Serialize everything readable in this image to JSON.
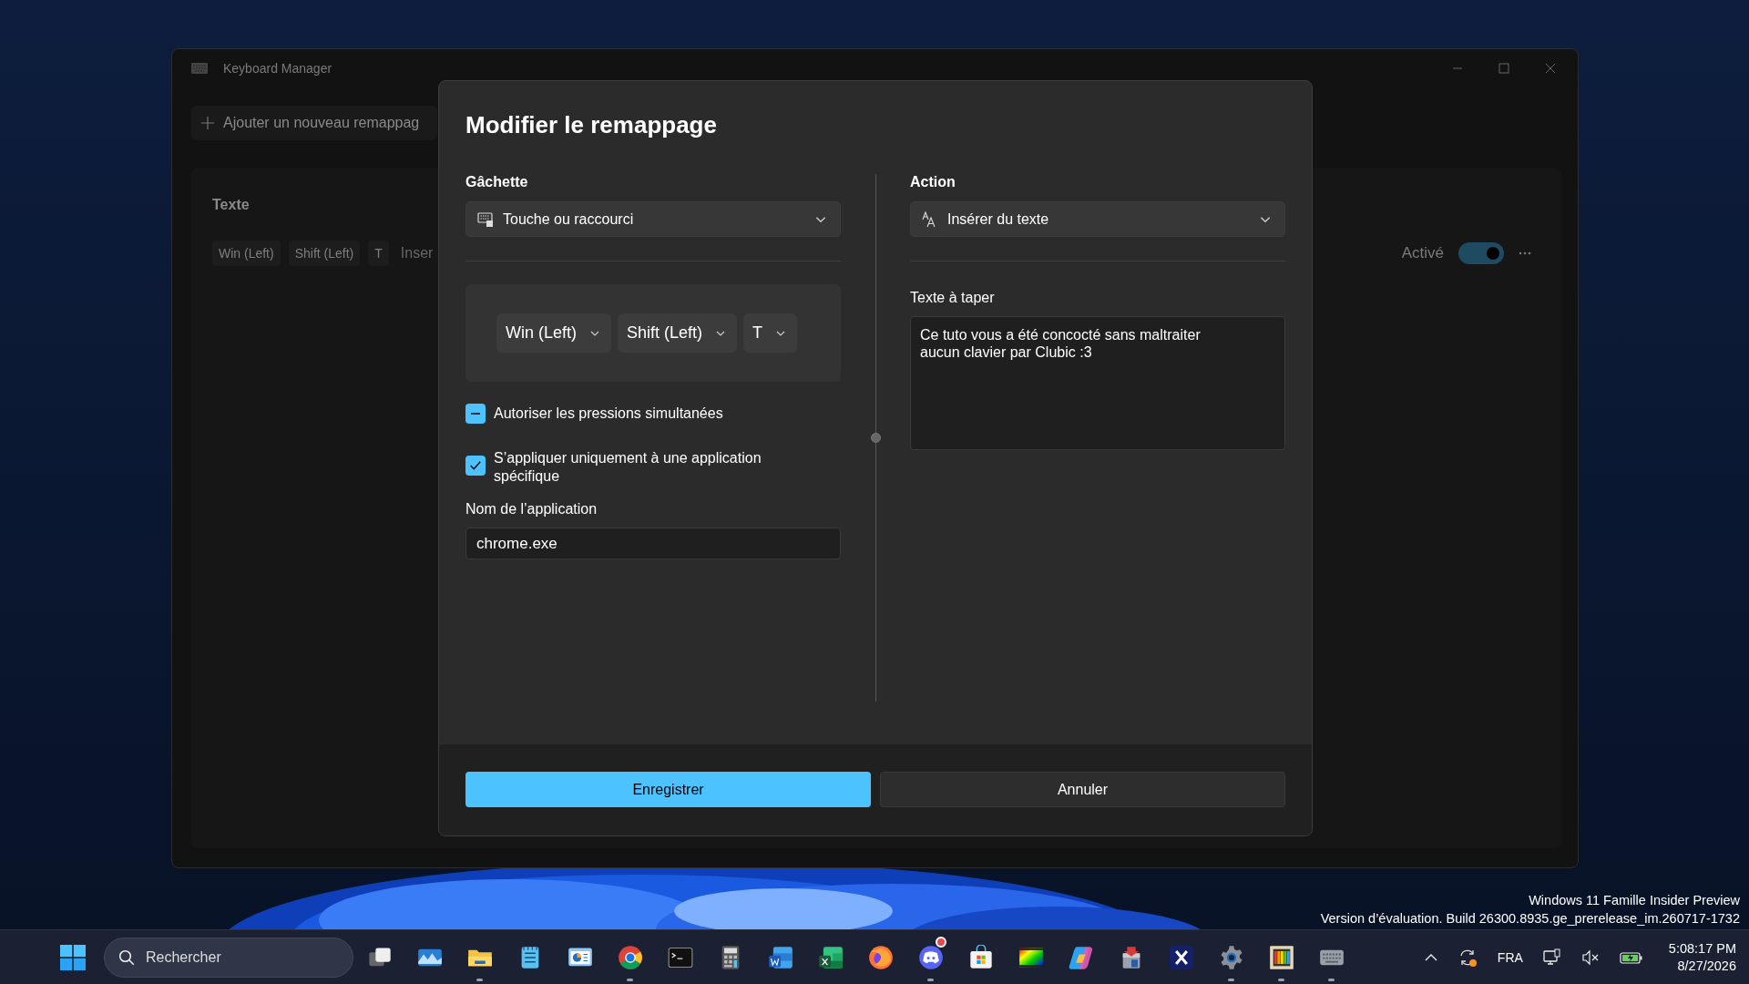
{
  "window": {
    "title": "Keyboard Manager",
    "add_button": "Ajouter un nouveau remappag",
    "card": {
      "title": "Texte",
      "keys": [
        "Win (Left)",
        "Shift (Left)",
        "T"
      ],
      "action": "Inser",
      "status": "Activé",
      "enabled": true
    }
  },
  "dialog": {
    "title": "Modifier le remappage",
    "trigger": {
      "label": "Gâchette",
      "type": "Touche ou raccourci",
      "keys": [
        "Win (Left)",
        "Shift (Left)",
        "T"
      ],
      "options": [
        {
          "label": "Autoriser les pressions simultanées",
          "checked": false,
          "indeterminate": true
        },
        {
          "label": "S’appliquer uniquement à une application spécifique",
          "checked": true,
          "indeterminate": false
        }
      ],
      "app_name": {
        "label": "Nom de l’application",
        "value": "chrome.exe"
      }
    },
    "action": {
      "label": "Action",
      "type": "Insérer du texte",
      "text": {
        "label": "Texte à taper",
        "value": "Ce tuto vous a été concocté sans maltraiter aucun clavier par Clubic :3"
      }
    },
    "buttons": [
      {
        "label": "Enregistrer",
        "kind": "primary"
      },
      {
        "label": "Annuler",
        "kind": "secondary"
      }
    ]
  },
  "taskbar": {
    "search": {
      "placeholder": "Rechercher"
    },
    "apps": [
      {
        "kind": "taskview",
        "running": false,
        "notification": false
      },
      {
        "kind": "photos",
        "running": false,
        "notification": false
      },
      {
        "kind": "explorer",
        "running": true,
        "notification": false
      },
      {
        "kind": "notepad",
        "running": false,
        "notification": false
      },
      {
        "kind": "slides",
        "running": false,
        "notification": false
      },
      {
        "kind": "chrome",
        "running": true,
        "notification": false
      },
      {
        "kind": "terminal",
        "running": false,
        "notification": false
      },
      {
        "kind": "calculator",
        "running": false,
        "notification": false
      },
      {
        "kind": "word",
        "running": false,
        "notification": false
      },
      {
        "kind": "excel",
        "running": false,
        "notification": false
      },
      {
        "kind": "firefox",
        "running": false,
        "notification": false
      },
      {
        "kind": "discord",
        "running": true,
        "notification": true
      },
      {
        "kind": "store",
        "running": false,
        "notification": false
      },
      {
        "kind": "colors",
        "running": false,
        "notification": false
      },
      {
        "kind": "copilot",
        "running": false,
        "notification": false
      },
      {
        "kind": "installer",
        "running": false,
        "notification": false
      },
      {
        "kind": "xapp",
        "running": false,
        "notification": false
      },
      {
        "kind": "settings",
        "running": true,
        "notification": false
      },
      {
        "kind": "paint",
        "running": true,
        "notification": false
      },
      {
        "kind": "keyboard",
        "running": true,
        "notification": false
      }
    ],
    "tray": {
      "language": "FRA",
      "time": "5:08:17 PM",
      "date": "8/27/2026"
    }
  },
  "watermark": {
    "edition": "Windows 11 Famille Insider Preview",
    "build": "Version d’évaluation. Build 26300.8935.ge_prerelease_im.260717-1732"
  }
}
